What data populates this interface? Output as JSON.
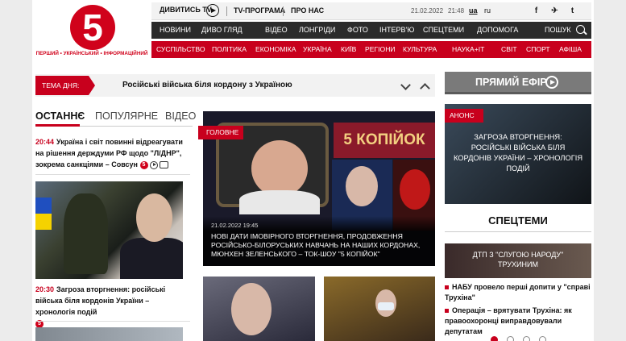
{
  "logo": {
    "mark": "5",
    "tagline": "ПЕРШИЙ • УКРАЇНСЬКИЙ • ІНФОРМАЦІЙНИЙ"
  },
  "topbar": {
    "watch_tv": "ДИВИТИСЬ TV",
    "tv_program": "TV-ПРОГРАМА",
    "about": "ПРО НАС",
    "date": "21.02.2022",
    "time": "21:48",
    "lang_ua": "ua",
    "lang_ru": "ru",
    "social": [
      "f",
      "✈",
      "t",
      "▶",
      "⌘"
    ]
  },
  "nav1": {
    "items": [
      "НОВИНИ",
      "ДИВО ГЛЯД",
      "ВІДЕО",
      "ЛОНГРІДИ",
      "ФОТО",
      "ІНТЕРВ'Ю",
      "СПЕЦТЕМИ",
      "ДОПОМОГА"
    ],
    "search": "ПОШУК"
  },
  "nav2": {
    "items": [
      "СУСПІЛЬСТВО",
      "ПОЛІТИКА",
      "ЕКОНОМІКА",
      "УКРАЇНА",
      "КИЇВ",
      "РЕГІОНИ",
      "КУЛЬТУРА",
      "НАУКА+IT",
      "СВІТ",
      "СПОРТ",
      "АФІША"
    ]
  },
  "tema": {
    "label": "ТЕМА ДНЯ:",
    "text": "Російські війська біля кордону з Україною"
  },
  "tabs": [
    "ОСТАННЄ",
    "ПОПУЛЯРНЕ",
    "ВІДЕО"
  ],
  "news": [
    {
      "time": "20:44",
      "text": "Україна і світ повинні відреагувати на рішення держдуми РФ щодо \"Л/ДНР\", зокрема санкціями – Совсун"
    },
    {
      "time": "20:30",
      "text": "Загроза вторгнення: російські війська біля кордонів України – хронологія подій"
    }
  ],
  "hero": {
    "label": "ГОЛОВНЕ",
    "show": "5 КОПІЙОК",
    "date": "21.02.2022 19:45",
    "title": "НОВІ ДАТИ ІМОВІРНОГО ВТОРГНЕННЯ, ПРОДОВЖЕННЯ РОСІЙСЬКО-БІЛОРУСЬКИХ НАВЧАНЬ НА НАШИХ КОРДОНАХ, МЮНХЕН ЗЕЛЕНСЬКОГО – ТОК-ШОУ \"5 КОПІЙОК\""
  },
  "live": {
    "text": "ПРЯМИЙ ЕФІР"
  },
  "anons": {
    "label": "АНОНС",
    "text": "ЗАГРОЗА ВТОРГНЕННЯ: РОСІЙСЬКІ ВІЙСЬКА БІЛЯ КОРДОНІВ УКРАЇНИ – ХРОНОЛОГІЯ ПОДІЙ"
  },
  "spec": {
    "title": "СПЕЦТЕМИ",
    "img_text": "ДТП З \"СЛУГОЮ НАРОДУ\" ТРУХИНИМ",
    "items": [
      "НАБУ провело перші допити у \"справі Трухіна\"",
      "Операція – врятувати Трухіна: як правоохоронці виправдовували депутатам"
    ]
  },
  "colors": {
    "brand_red": "#c8001d",
    "dark_nav": "#2b2b2b"
  }
}
